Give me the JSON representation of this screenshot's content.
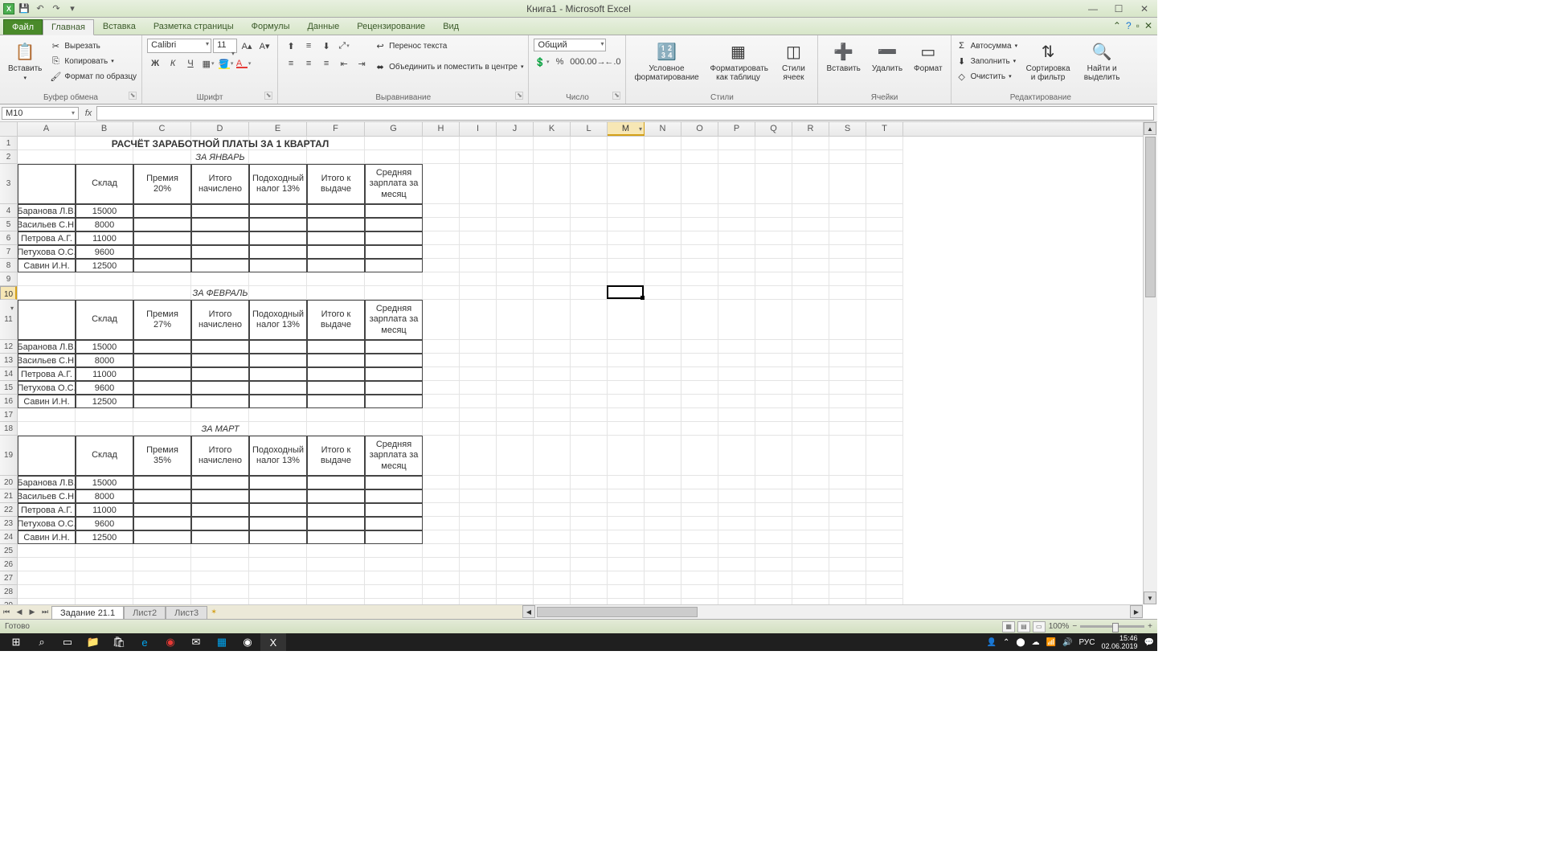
{
  "title": "Книга1 - Microsoft Excel",
  "qat": {
    "save": "💾",
    "undo": "↶",
    "redo": "↷"
  },
  "tabs": {
    "file": "Файл",
    "home": "Главная",
    "insert": "Вставка",
    "layout": "Разметка страницы",
    "formulas": "Формулы",
    "data": "Данные",
    "review": "Рецензирование",
    "view": "Вид"
  },
  "ribbon": {
    "clipboard": {
      "paste": "Вставить",
      "cut": "Вырезать",
      "copy": "Копировать",
      "format": "Формат по образцу",
      "label": "Буфер обмена"
    },
    "font": {
      "name": "Calibri",
      "size": "11",
      "label": "Шрифт"
    },
    "align": {
      "wrap": "Перенос текста",
      "merge": "Объединить и поместить в центре",
      "label": "Выравнивание"
    },
    "number": {
      "format": "Общий",
      "label": "Число"
    },
    "styles": {
      "cond": "Условное форматирование",
      "table": "Форматировать как таблицу",
      "cell": "Стили ячеек",
      "label": "Стили"
    },
    "cells": {
      "insert": "Вставить",
      "delete": "Удалить",
      "format": "Формат",
      "label": "Ячейки"
    },
    "editing": {
      "sum": "Автосумма",
      "fill": "Заполнить",
      "clear": "Очистить",
      "sort": "Сортировка и фильтр",
      "find": "Найти и выделить",
      "label": "Редактирование"
    }
  },
  "namebox": "M10",
  "cols": [
    "A",
    "B",
    "C",
    "D",
    "E",
    "F",
    "G",
    "H",
    "I",
    "J",
    "K",
    "L",
    "M",
    "N",
    "O",
    "P",
    "Q",
    "R",
    "S",
    "T"
  ],
  "colw": {
    "A": 72,
    "B": 72,
    "C": 72,
    "D": 72,
    "E": 72,
    "F": 72,
    "G": 72,
    "def": 46
  },
  "title_row": "РАСЧЁТ ЗАРАБОТНОЙ ПЛАТЫ ЗА 1 КВАРТАЛ",
  "months": {
    "jan": "ЗА ЯНВАРЬ",
    "feb": "ЗА ФЕВРАЛЬ",
    "mar": "ЗА МАРТ"
  },
  "headers": {
    "b": "Склад",
    "jan_c": "Премия 20%",
    "feb_c": "Премия 27%",
    "mar_c": "Премия 35%",
    "d": "Итого начислено",
    "e": "Подоходный налог 13%",
    "f": "Итого к выдаче",
    "g": "Средняя зарплата за месяц"
  },
  "emp": [
    {
      "name": "Баранова Л.В.",
      "val": "15000"
    },
    {
      "name": "Васильев С.Н.",
      "val": "8000"
    },
    {
      "name": "Петрова А.Г.",
      "val": "11000"
    },
    {
      "name": "Петухова О.С.",
      "val": "9600"
    },
    {
      "name": "Савин И.Н.",
      "val": "12500"
    }
  ],
  "sheets": {
    "s1": "Задание 21.1",
    "s2": "Лист2",
    "s3": "Лист3"
  },
  "status": "Готово",
  "zoom": "100%",
  "lang": "РУС",
  "time": "15:46",
  "date": "02.06.2019"
}
